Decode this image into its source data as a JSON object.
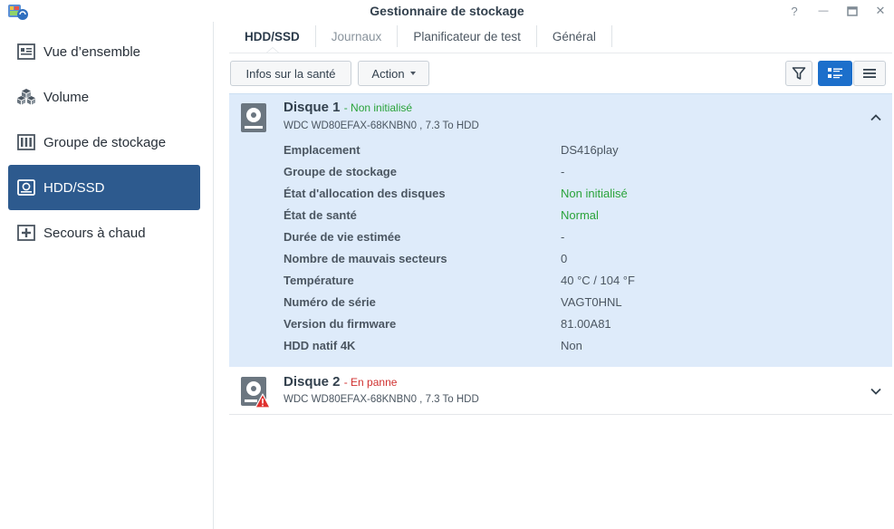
{
  "window": {
    "title": "Gestionnaire de stockage",
    "help_glyph": "?",
    "min_glyph": "—",
    "max_glyph": "□",
    "close_glyph": "✕"
  },
  "sidebar": {
    "items": [
      {
        "label": "Vue d’ensemble",
        "icon": "overview-icon",
        "active": false
      },
      {
        "label": "Volume",
        "icon": "volume-cubes-icon",
        "active": false
      },
      {
        "label": "Groupe de stockage",
        "icon": "storage-pool-icon",
        "active": false
      },
      {
        "label": "HDD/SSD",
        "icon": "hdd-icon",
        "active": true
      },
      {
        "label": "Secours à chaud",
        "icon": "hot-spare-plus-icon",
        "active": false
      }
    ]
  },
  "tabs": [
    {
      "label": "HDD/SSD",
      "active": true
    },
    {
      "label": "Journaux",
      "active": false
    },
    {
      "label": "Planificateur de test",
      "active": false
    },
    {
      "label": "Général",
      "active": false
    }
  ],
  "toolbar": {
    "health_label": "Infos sur la santé",
    "action_label": "Action",
    "filter_icon": "filter-icon",
    "list_view_icon": "detail-list-icon",
    "compact_view_icon": "compact-list-icon"
  },
  "disks": [
    {
      "name": "Disque 1",
      "status": "- Non initialisé",
      "model": "WDC WD80EFAX-68KNBN0 , 7.3 To HDD",
      "expanded": true,
      "details": [
        {
          "key": "Emplacement",
          "value": "DS416play",
          "color": "normal"
        },
        {
          "key": "Groupe de stockage",
          "value": "-",
          "color": "normal"
        },
        {
          "key": "État d'allocation des disques",
          "value": "Non initialisé",
          "color": "green"
        },
        {
          "key": "État de santé",
          "value": "Normal",
          "color": "green"
        },
        {
          "key": "Durée de vie estimée",
          "value": "-",
          "color": "normal"
        },
        {
          "key": "Nombre de mauvais secteurs",
          "value": "0",
          "color": "normal"
        },
        {
          "key": "Température",
          "value": "40 °C / 104 °F",
          "color": "normal"
        },
        {
          "key": "Numéro de série",
          "value": "VAGT0HNL",
          "color": "normal"
        },
        {
          "key": "Version du firmware",
          "value": "81.00A81",
          "color": "normal"
        },
        {
          "key": "HDD natif 4K",
          "value": "Non",
          "color": "normal"
        }
      ]
    },
    {
      "name": "Disque 2",
      "status": "- En panne",
      "model": "WDC WD80EFAX-68KNBN0 , 7.3 To HDD",
      "expanded": false,
      "warning_icon": "warning-triangle-icon"
    }
  ],
  "colors": {
    "accent": "#1c6fcb",
    "sidebar_active": "#2d5a8e",
    "selected_row": "#deebfa",
    "ok": "#2aa33a",
    "error": "#d0302f"
  }
}
